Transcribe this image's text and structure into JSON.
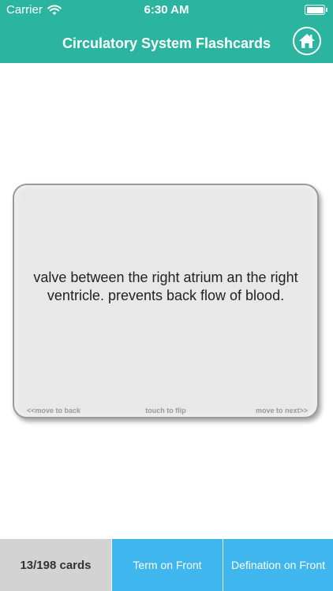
{
  "status_bar": {
    "carrier": "Carrier",
    "time": "6:30 AM"
  },
  "header": {
    "title": "Circulatory System Flashcards",
    "home_icon": "home-icon"
  },
  "card": {
    "text": "valve between the right atrium an the right ventricle. prevents back flow of blood.",
    "hint_back": "<<move to back",
    "hint_flip": "touch to flip",
    "hint_next": "move to next>>"
  },
  "bottom_bar": {
    "count": "13/198 cards",
    "term_button": "Term on Front",
    "definition_button": "Defination on Front"
  },
  "colors": {
    "header": "#2bb5a0",
    "button_blue": "#3fb6ee",
    "count_gray": "#d3d3d3",
    "card_bg": "#e8e8e8"
  }
}
